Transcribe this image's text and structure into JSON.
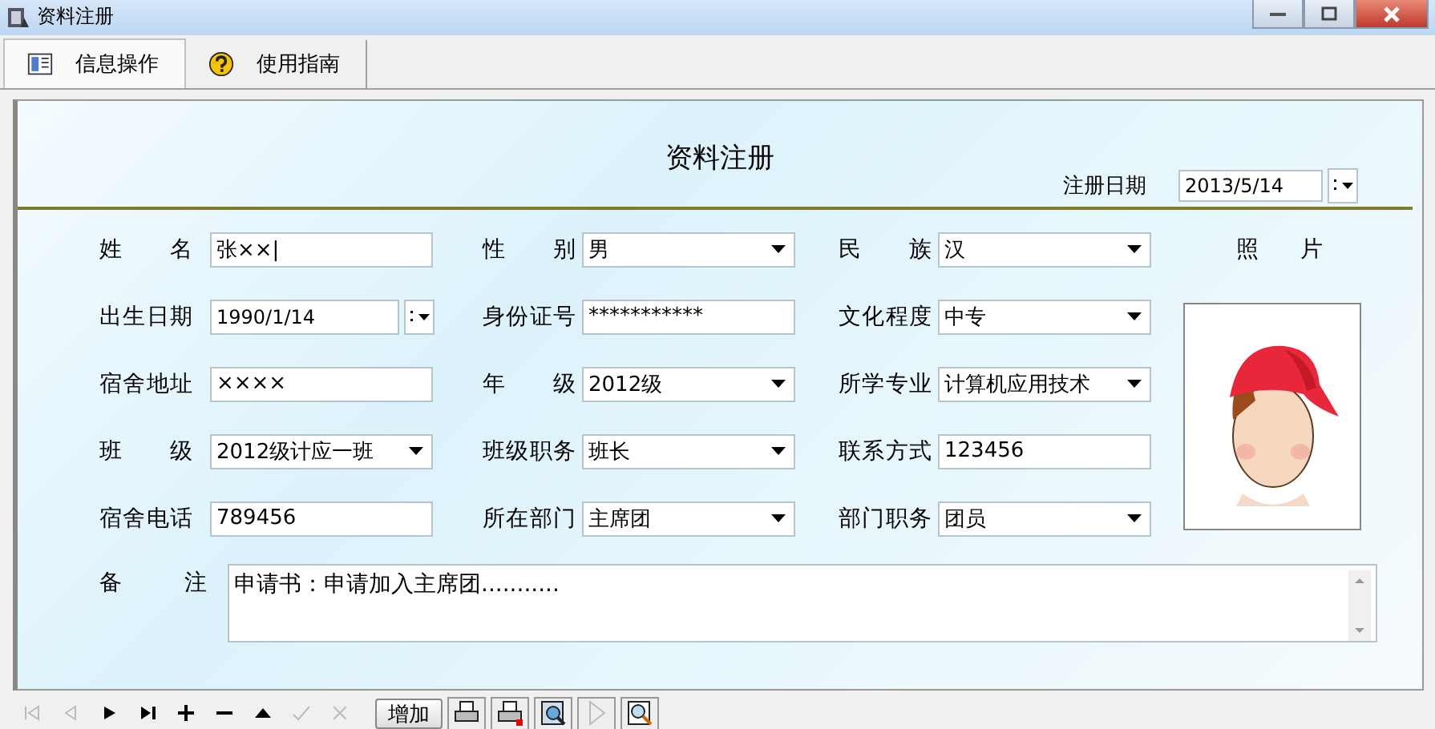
{
  "window": {
    "title": "资料注册"
  },
  "tabs": [
    {
      "label": "信息操作",
      "selected": true
    },
    {
      "label": "使用指南",
      "selected": false
    }
  ],
  "form": {
    "title": "资料注册",
    "register_date": {
      "label": "注册日期",
      "value": "2013/5/14"
    },
    "rows": [
      [
        {
          "label": "姓 名",
          "value": "张××|",
          "kind": "text"
        },
        {
          "label": "性 别",
          "value": "男",
          "kind": "combo"
        },
        {
          "label": "民 族",
          "value": "汉",
          "kind": "combo"
        }
      ],
      [
        {
          "label": "出生日期",
          "value": "1990/1/14",
          "kind": "date"
        },
        {
          "label": "身份证号",
          "value": "***********",
          "kind": "text"
        },
        {
          "label": "文化程度",
          "value": "中专",
          "kind": "combo"
        }
      ],
      [
        {
          "label": "宿舍地址",
          "value": "××××",
          "kind": "text"
        },
        {
          "label": "年 级",
          "value": "2012级",
          "kind": "combo"
        },
        {
          "label": "所学专业",
          "value": "计算机应用技术",
          "kind": "combo"
        }
      ],
      [
        {
          "label": "班 级",
          "value": "2012级计应一班",
          "kind": "combo"
        },
        {
          "label": "班级职务",
          "value": "班长",
          "kind": "combo"
        },
        {
          "label": "联系方式",
          "value": "123456",
          "kind": "text"
        }
      ],
      [
        {
          "label": "宿舍电话",
          "value": "789456",
          "kind": "text"
        },
        {
          "label": "所在部门",
          "value": "主席团",
          "kind": "combo"
        },
        {
          "label": "部门职务",
          "value": "团员",
          "kind": "combo"
        }
      ]
    ],
    "photo": {
      "label": "照 片",
      "kind": "picture"
    },
    "remark": {
      "label": "备 注",
      "value": "申请书：申请加入主席团..........."
    }
  },
  "toolbar": {
    "nav": [
      {
        "kind": "first",
        "disabled": true
      },
      {
        "kind": "prior",
        "disabled": true
      },
      {
        "kind": "next",
        "disabled": false
      },
      {
        "kind": "last",
        "disabled": false
      },
      {
        "kind": "insert",
        "disabled": false
      },
      {
        "kind": "delete",
        "disabled": false
      },
      {
        "kind": "edit",
        "disabled": false
      },
      {
        "kind": "post",
        "disabled": true
      },
      {
        "kind": "cancel",
        "disabled": true
      }
    ],
    "add_button": "增加",
    "tools": [
      {
        "kind": "print",
        "disabled": false
      },
      {
        "kind": "print-red",
        "disabled": false
      },
      {
        "kind": "preview",
        "disabled": false
      },
      {
        "kind": "play",
        "disabled": true
      },
      {
        "kind": "find",
        "disabled": false
      }
    ]
  }
}
